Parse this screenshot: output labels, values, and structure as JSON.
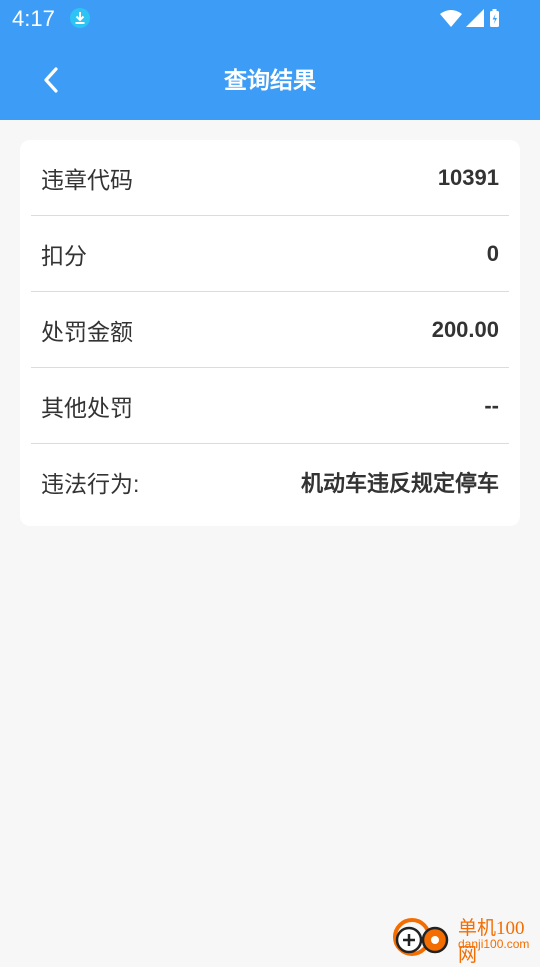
{
  "status_bar": {
    "time": "4:17"
  },
  "header": {
    "title": "查询结果"
  },
  "details": [
    {
      "label": "违章代码",
      "value": "10391"
    },
    {
      "label": "扣分",
      "value": "0"
    },
    {
      "label": "处罚金额",
      "value": "200.00"
    },
    {
      "label": "其他处罚",
      "value": "--"
    },
    {
      "label": "违法行为:",
      "value": "机动车违反规定停车"
    }
  ],
  "watermark": {
    "name": "单机100网",
    "url": "danji100.com"
  },
  "colors": {
    "accent": "#3d9df6",
    "background": "#f7f7f7",
    "card": "#ffffff",
    "divider": "#dcdcdc",
    "watermark": "#f36d00"
  }
}
